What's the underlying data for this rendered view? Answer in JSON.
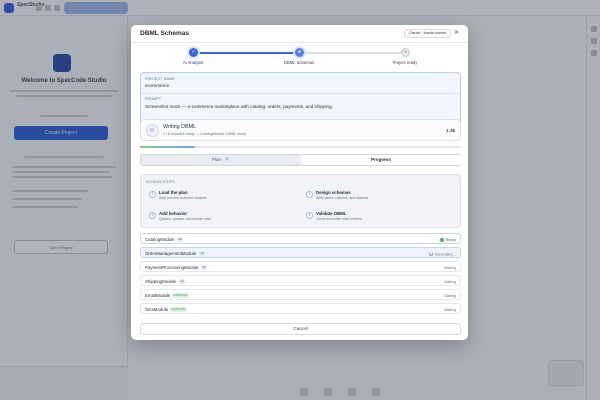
{
  "modal": {
    "title": "DBML Schemas",
    "model_label": "Claude · claude-sonnet",
    "close_glyph": "✕"
  },
  "stepper": {
    "steps": [
      {
        "label": "AI Analysis",
        "state": "complete",
        "glyph": "✓"
      },
      {
        "label": "DBML Schemas",
        "state": "active",
        "glyph": "●"
      },
      {
        "label": "Project ready",
        "state": "pending",
        "glyph": "●"
      }
    ]
  },
  "project": {
    "name_label": "PROJECT NAME",
    "name_value": "ecommerce",
    "prompt_label": "PROMPT",
    "prompt_value": "Screenshot mock — e-commerce marketplace with catalog, orders, payments, and shipping."
  },
  "writing": {
    "title": "Writing DBML",
    "subtitle": "1 / 6 modules ready — CatalogModule: DBML ready",
    "elapsed": "1:36",
    "progress": 0.17
  },
  "tabs": {
    "plan_label": "Plan",
    "plan_count": "6",
    "progress_label": "Progress",
    "active": "progress"
  },
  "schema_steps": {
    "heading": "SCHEMA STEPS",
    "items": [
      {
        "num": "1",
        "title": "Load the plan",
        "desc": "Start from the reviewed modules"
      },
      {
        "num": "2",
        "title": "Design schemas",
        "desc": "Write tables, columns, and relations"
      },
      {
        "num": "3",
        "title": "Add behavior",
        "desc": "Queries, updates, and domain rules"
      },
      {
        "num": "4",
        "title": "Validate DBML",
        "desc": "Check and polish each schema"
      }
    ]
  },
  "modules": [
    {
      "name": "CatalogModule",
      "tag": "10",
      "tag_color": "blue",
      "status": "Ready",
      "state": "ready"
    },
    {
      "name": "OrderManagementModule",
      "tag": "10",
      "tag_color": "blue",
      "status": "Generating…",
      "state": "generating"
    },
    {
      "name": "PaymentProcessingModule",
      "tag": "10",
      "tag_color": "blue",
      "status": "Waiting",
      "state": "waiting"
    },
    {
      "name": "ShippingModule",
      "tag": "10",
      "tag_color": "blue",
      "status": "Waiting",
      "state": "waiting"
    },
    {
      "name": "EmailModule",
      "tag": "CATALOG",
      "tag_color": "green",
      "status": "Waiting",
      "state": "waiting"
    },
    {
      "name": "SmsModule",
      "tag": "CATALOG",
      "tag_color": "green",
      "status": "Waiting",
      "state": "waiting"
    }
  ],
  "footer": {
    "cancel_label": "Cancel"
  },
  "background": {
    "brand": "SpecStudio",
    "welcome": "Welcome to SpecCode Studio",
    "cta_label": "Create Project",
    "secondary_label": "Open Project"
  },
  "colors": {
    "accent": "#3d63d6",
    "ready": "#34a853",
    "overlay": "rgba(30,38,52,0.32)"
  }
}
